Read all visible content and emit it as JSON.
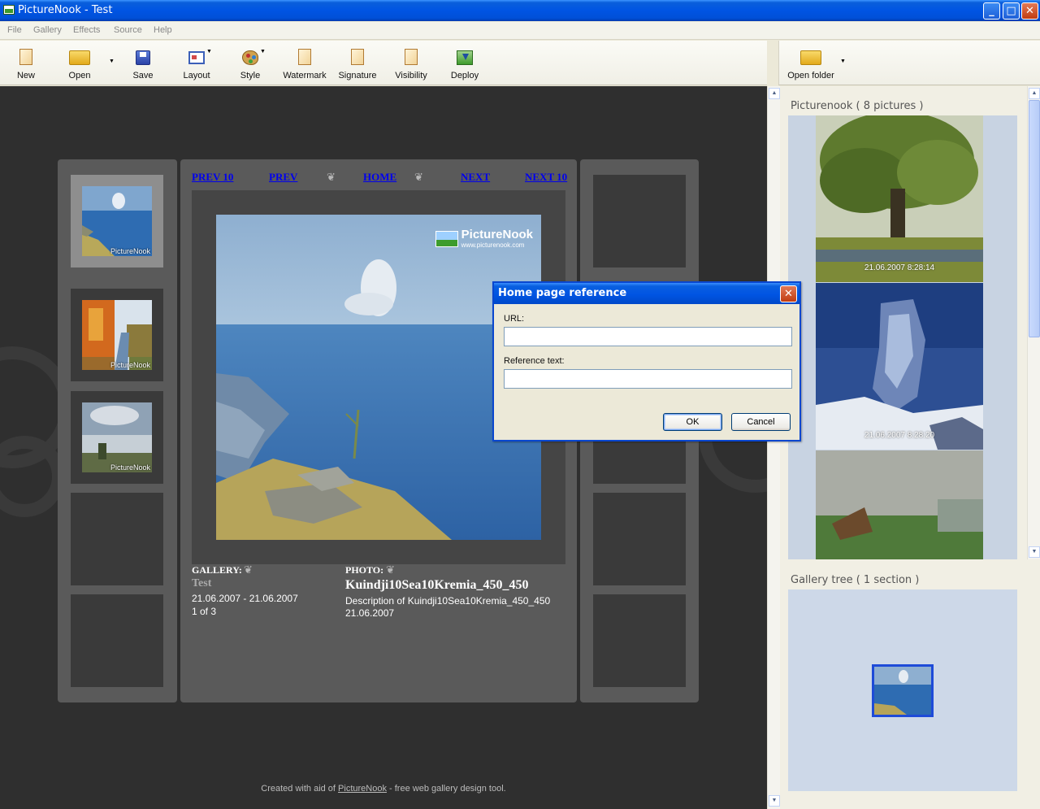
{
  "window": {
    "title": "PictureNook - Test",
    "controls": [
      "_",
      "□",
      "✕"
    ]
  },
  "menu": [
    "File",
    "Gallery",
    "Effects",
    "Source",
    "Help"
  ],
  "toolbar": {
    "new": "New",
    "open": "Open",
    "save": "Save",
    "layout": "Layout",
    "style": "Style",
    "watermark": "Watermark",
    "signature": "Signature",
    "visibility": "Visibility",
    "deploy": "Deploy",
    "open_folder": "Open folder"
  },
  "preview": {
    "nav": {
      "prev10": "PREV 10",
      "prev": "PREV",
      "home": "HOME",
      "next": "NEXT",
      "next10": "NEXT 10",
      "ornament": "❦"
    },
    "thumb_caption": "PictureNook",
    "watermark": {
      "title": "PictureNook",
      "url": "www.picturenook.com"
    },
    "gallery": {
      "label": "GALLERY:",
      "name": "Test",
      "dates": "21.06.2007 - 21.06.2007",
      "count": "1 of 3"
    },
    "photo": {
      "label": "PHOTO:",
      "name": "Kuindji10Sea10Kremia_450_450",
      "description": "Description of Kuindji10Sea10Kremia_450_450",
      "date": "21.06.2007"
    },
    "footer": {
      "prefix": "Created with aid of ",
      "link": "PictureNook",
      "suffix": " - free web gallery design tool."
    }
  },
  "sidebar": {
    "pictures_title": "Picturenook ( 8 pictures )",
    "pictures": [
      {
        "caption": "21.06.2007 8:28:14"
      },
      {
        "caption": "21.06.2007 8:28:20"
      },
      {
        "caption": ""
      }
    ],
    "tree_title": "Gallery tree ( 1 section )"
  },
  "dialog": {
    "title": "Home page reference",
    "url_label": "URL:",
    "url_value": "",
    "ref_label": "Reference text:",
    "ref_value": "",
    "ok": "OK",
    "cancel": "Cancel"
  },
  "colors": {
    "preview_bg": "#2F2F2F",
    "panel": "#5A5A5A",
    "link": "#0000EE",
    "title_bar": "#0054E3"
  }
}
